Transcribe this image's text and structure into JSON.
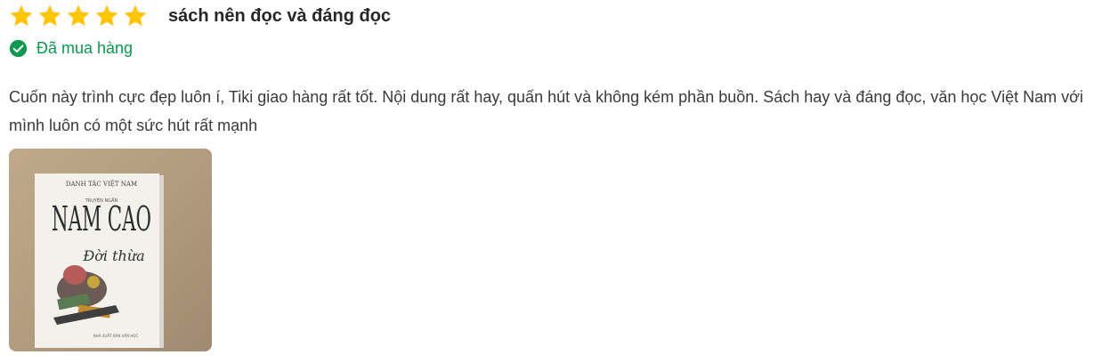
{
  "review": {
    "rating": 5,
    "max_rating": 5,
    "star_icon": "star-icon",
    "star_color": "#ffc400",
    "title": "sách nên đọc và đáng đọc",
    "purchased": {
      "icon": "check-circle-icon",
      "label": "Đã mua hàng",
      "color": "#0b9a4d"
    },
    "body": "Cuốn này trình cực đẹp luôn í, Tiki giao hàng rất tốt. Nội dung rất hay, quấn hút và không kém phần buồn. Sách hay và đáng đọc, văn học Việt Nam với mình luôn có một sức hút rất mạnh",
    "photo": {
      "cover_series": "DANH TÁC VIỆT NAM",
      "cover_author": "NAM CAO",
      "cover_subtitle": "TRUYỆN NGẮN",
      "cover_title": "Đời thừa",
      "cover_publisher": "NHÀ XUẤT BẢN VĂN HỌC"
    }
  }
}
